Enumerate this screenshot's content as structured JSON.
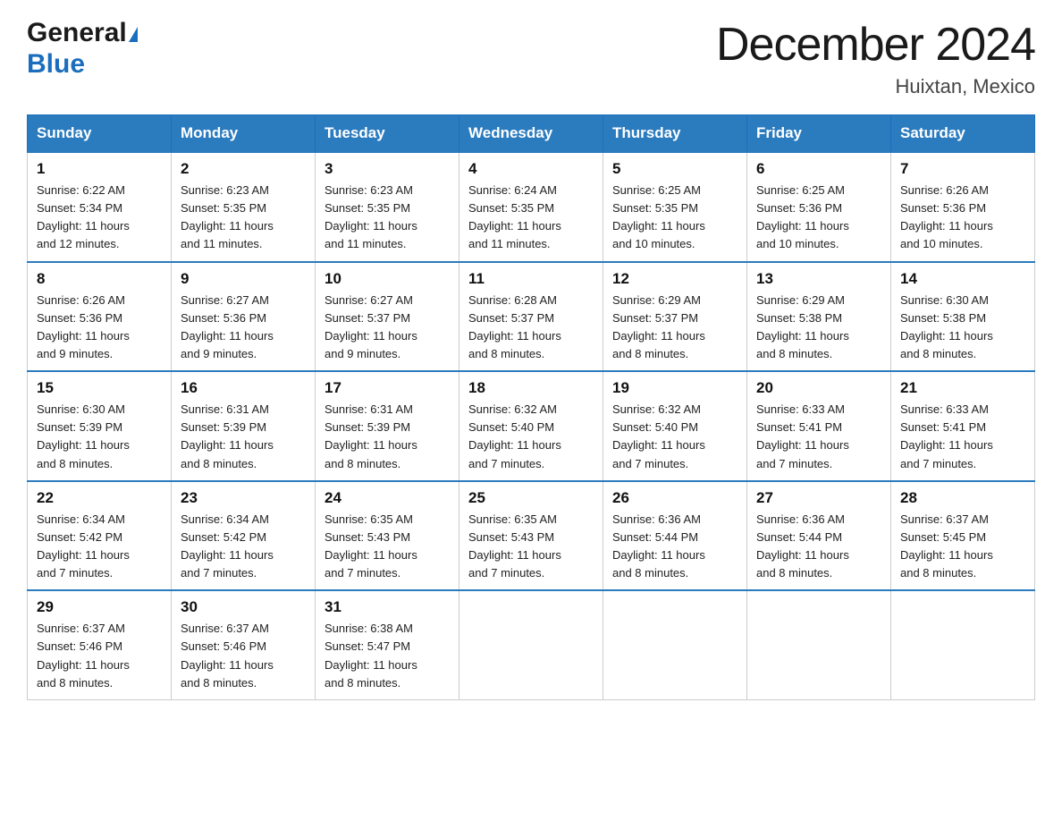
{
  "header": {
    "logo_line1": "General",
    "logo_line2": "Blue",
    "month_title": "December 2024",
    "location": "Huixtan, Mexico"
  },
  "days_of_week": [
    "Sunday",
    "Monday",
    "Tuesday",
    "Wednesday",
    "Thursday",
    "Friday",
    "Saturday"
  ],
  "weeks": [
    [
      {
        "day": "1",
        "sunrise": "6:22 AM",
        "sunset": "5:34 PM",
        "daylight": "11 hours and 12 minutes."
      },
      {
        "day": "2",
        "sunrise": "6:23 AM",
        "sunset": "5:35 PM",
        "daylight": "11 hours and 11 minutes."
      },
      {
        "day": "3",
        "sunrise": "6:23 AM",
        "sunset": "5:35 PM",
        "daylight": "11 hours and 11 minutes."
      },
      {
        "day": "4",
        "sunrise": "6:24 AM",
        "sunset": "5:35 PM",
        "daylight": "11 hours and 11 minutes."
      },
      {
        "day": "5",
        "sunrise": "6:25 AM",
        "sunset": "5:35 PM",
        "daylight": "11 hours and 10 minutes."
      },
      {
        "day": "6",
        "sunrise": "6:25 AM",
        "sunset": "5:36 PM",
        "daylight": "11 hours and 10 minutes."
      },
      {
        "day": "7",
        "sunrise": "6:26 AM",
        "sunset": "5:36 PM",
        "daylight": "11 hours and 10 minutes."
      }
    ],
    [
      {
        "day": "8",
        "sunrise": "6:26 AM",
        "sunset": "5:36 PM",
        "daylight": "11 hours and 9 minutes."
      },
      {
        "day": "9",
        "sunrise": "6:27 AM",
        "sunset": "5:36 PM",
        "daylight": "11 hours and 9 minutes."
      },
      {
        "day": "10",
        "sunrise": "6:27 AM",
        "sunset": "5:37 PM",
        "daylight": "11 hours and 9 minutes."
      },
      {
        "day": "11",
        "sunrise": "6:28 AM",
        "sunset": "5:37 PM",
        "daylight": "11 hours and 8 minutes."
      },
      {
        "day": "12",
        "sunrise": "6:29 AM",
        "sunset": "5:37 PM",
        "daylight": "11 hours and 8 minutes."
      },
      {
        "day": "13",
        "sunrise": "6:29 AM",
        "sunset": "5:38 PM",
        "daylight": "11 hours and 8 minutes."
      },
      {
        "day": "14",
        "sunrise": "6:30 AM",
        "sunset": "5:38 PM",
        "daylight": "11 hours and 8 minutes."
      }
    ],
    [
      {
        "day": "15",
        "sunrise": "6:30 AM",
        "sunset": "5:39 PM",
        "daylight": "11 hours and 8 minutes."
      },
      {
        "day": "16",
        "sunrise": "6:31 AM",
        "sunset": "5:39 PM",
        "daylight": "11 hours and 8 minutes."
      },
      {
        "day": "17",
        "sunrise": "6:31 AM",
        "sunset": "5:39 PM",
        "daylight": "11 hours and 8 minutes."
      },
      {
        "day": "18",
        "sunrise": "6:32 AM",
        "sunset": "5:40 PM",
        "daylight": "11 hours and 7 minutes."
      },
      {
        "day": "19",
        "sunrise": "6:32 AM",
        "sunset": "5:40 PM",
        "daylight": "11 hours and 7 minutes."
      },
      {
        "day": "20",
        "sunrise": "6:33 AM",
        "sunset": "5:41 PM",
        "daylight": "11 hours and 7 minutes."
      },
      {
        "day": "21",
        "sunrise": "6:33 AM",
        "sunset": "5:41 PM",
        "daylight": "11 hours and 7 minutes."
      }
    ],
    [
      {
        "day": "22",
        "sunrise": "6:34 AM",
        "sunset": "5:42 PM",
        "daylight": "11 hours and 7 minutes."
      },
      {
        "day": "23",
        "sunrise": "6:34 AM",
        "sunset": "5:42 PM",
        "daylight": "11 hours and 7 minutes."
      },
      {
        "day": "24",
        "sunrise": "6:35 AM",
        "sunset": "5:43 PM",
        "daylight": "11 hours and 7 minutes."
      },
      {
        "day": "25",
        "sunrise": "6:35 AM",
        "sunset": "5:43 PM",
        "daylight": "11 hours and 7 minutes."
      },
      {
        "day": "26",
        "sunrise": "6:36 AM",
        "sunset": "5:44 PM",
        "daylight": "11 hours and 8 minutes."
      },
      {
        "day": "27",
        "sunrise": "6:36 AM",
        "sunset": "5:44 PM",
        "daylight": "11 hours and 8 minutes."
      },
      {
        "day": "28",
        "sunrise": "6:37 AM",
        "sunset": "5:45 PM",
        "daylight": "11 hours and 8 minutes."
      }
    ],
    [
      {
        "day": "29",
        "sunrise": "6:37 AM",
        "sunset": "5:46 PM",
        "daylight": "11 hours and 8 minutes."
      },
      {
        "day": "30",
        "sunrise": "6:37 AM",
        "sunset": "5:46 PM",
        "daylight": "11 hours and 8 minutes."
      },
      {
        "day": "31",
        "sunrise": "6:38 AM",
        "sunset": "5:47 PM",
        "daylight": "11 hours and 8 minutes."
      },
      null,
      null,
      null,
      null
    ]
  ],
  "labels": {
    "sunrise": "Sunrise:",
    "sunset": "Sunset:",
    "daylight": "Daylight:"
  }
}
